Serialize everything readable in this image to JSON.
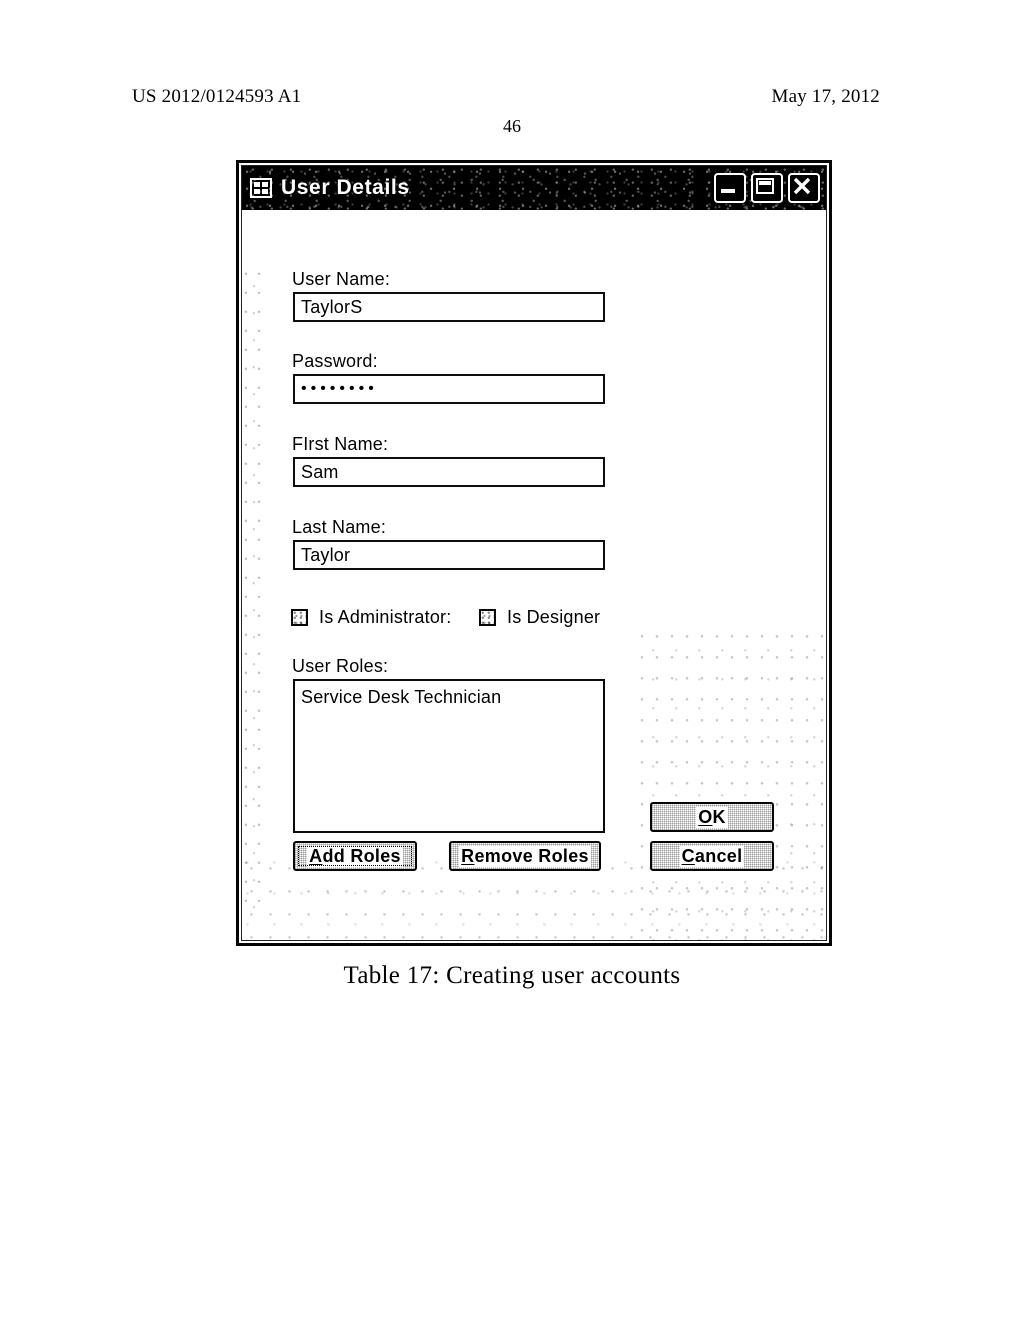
{
  "page": {
    "publication_number": "US 2012/0124593 A1",
    "publication_date": "May 17, 2012",
    "page_number": "46",
    "figure_caption": "Table 17: Creating user accounts"
  },
  "window": {
    "title": "User Details",
    "icon": "form-window-icon",
    "controls": {
      "minimize": "minimize-icon",
      "maximize": "maximize-icon",
      "close": "close-icon"
    }
  },
  "form": {
    "user_name": {
      "label": "User Name:",
      "value": "TaylorS",
      "placeholder": ""
    },
    "password": {
      "label": "Password:",
      "value": "••••••••",
      "placeholder": ""
    },
    "first_name": {
      "label": "FIrst Name:",
      "value": "Sam",
      "placeholder": ""
    },
    "last_name": {
      "label": "Last Name:",
      "value": "Taylor",
      "placeholder": ""
    },
    "is_administrator": {
      "label": "Is Administrator:",
      "checked": false
    },
    "is_designer": {
      "label": "Is Designer",
      "checked": false
    },
    "user_roles": {
      "label": "User Roles:",
      "items": [
        "Service Desk Technician"
      ]
    }
  },
  "buttons": {
    "add_roles": {
      "label": "Add Roles",
      "accel": "A",
      "focused": true
    },
    "remove_roles": {
      "label": "Remove Roles",
      "accel": "R",
      "focused": false
    },
    "ok": {
      "label": "OK",
      "accel": "O",
      "focused": false
    },
    "cancel": {
      "label": "Cancel",
      "accel": "C",
      "focused": false
    }
  }
}
